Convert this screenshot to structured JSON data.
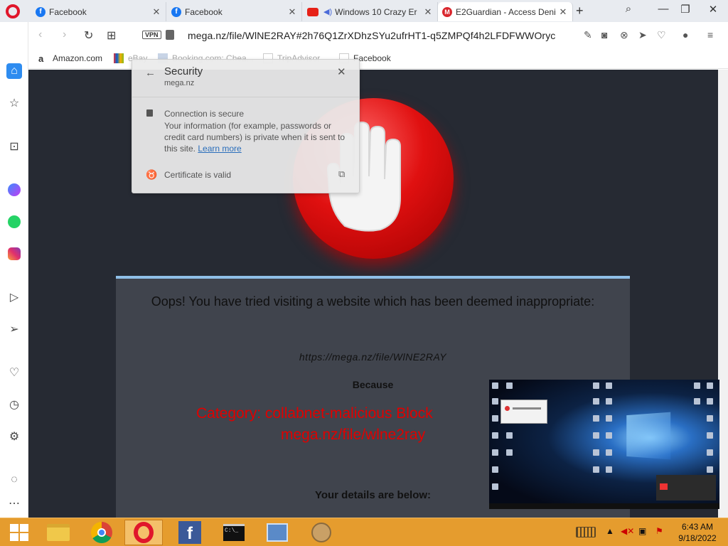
{
  "browser": {
    "tabs": [
      {
        "title": "Facebook",
        "icon": "facebook-icon",
        "active": false
      },
      {
        "title": "Facebook",
        "icon": "facebook-icon",
        "active": false
      },
      {
        "title": "Windows 10 Crazy Er",
        "icon": "youtube-icon",
        "audio": true,
        "active": false
      },
      {
        "title": "E2Guardian - Access Deni",
        "icon": "mega-icon",
        "active": true
      }
    ],
    "new_tab_label": "+",
    "url": "mega.nz/file/WlNE2RAY#2h76Q1ZrXDhzSYu2ufrHT1-q5ZMPQf4h2LFDFWWOryc",
    "vpn_label": "VPN"
  },
  "bookmarks": [
    {
      "label": "Amazon.com",
      "faded": false
    },
    {
      "label": "eBay",
      "faded": true
    },
    {
      "label": "Booking.com: Chea...",
      "faded": true
    },
    {
      "label": "TripAdvisor",
      "faded": true
    },
    {
      "label": "Facebook",
      "faded": false
    }
  ],
  "security_popup": {
    "title": "Security",
    "domain": "mega.nz",
    "connection": "Connection is secure",
    "description": "Your information (for example, passwords or credit card numbers) is private when it is sent to this site.",
    "learn_more": "Learn more",
    "certificate": "Certificate is valid"
  },
  "block_page": {
    "heading": "Oops! You have tried visiting a website which has been deemed inappropriate:",
    "blocked_url": "https://mega.nz/file/WlNE2RAY",
    "because": "Because",
    "category_line1": "Category: collabnet-malicious  Block",
    "category_line2": "mega.nz/file/wlne2ray",
    "details": "Your details are below:",
    "category_color": "#e00000"
  },
  "taskbar": {
    "time": "6:43 AM",
    "date": "9/18/2022",
    "color": "#e59c2e"
  }
}
